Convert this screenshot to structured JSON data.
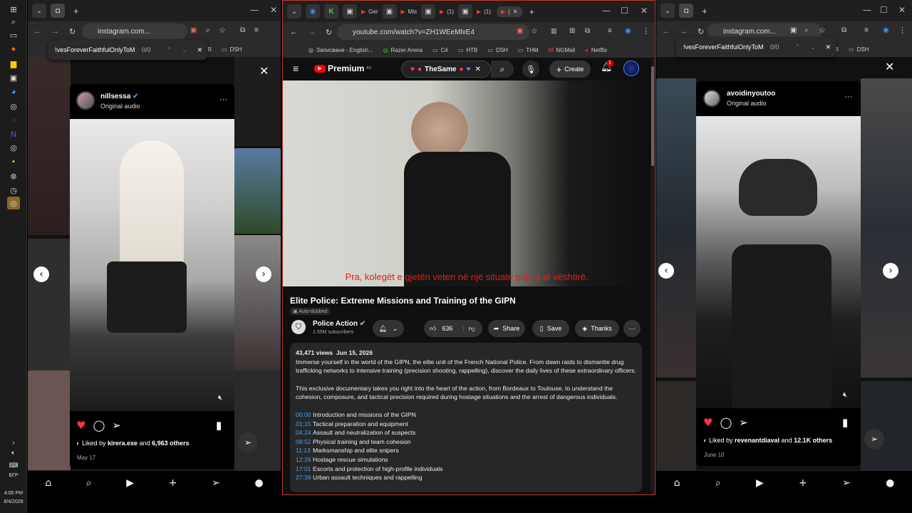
{
  "taskbar": {
    "time": "4:05 PM",
    "date": "8/4/2026",
    "lang": "БГР"
  },
  "left_window": {
    "url": "instagram.com...",
    "find_text": "!vesForeverFaithfulOnlyToMe.",
    "find_count": "0/0",
    "bookmarks": [
      "HTB",
      "DSH"
    ],
    "post": {
      "username": "nillsessa",
      "audio": "Original audio",
      "liked_by_prefix": "Liked by",
      "liked_by_user": "kirera.exe",
      "liked_by_and": "and",
      "liked_by_others": "6,963 others",
      "date": "May 17"
    }
  },
  "right_window": {
    "url": "instagram.com...",
    "find_text": "!vesForeverFaithfulOnlyToMe.",
    "find_count": "0/0",
    "bookmarks": [
      "HTB",
      "DSH"
    ],
    "post": {
      "username": "avoidinyoutoo",
      "audio": "Original audio",
      "liked_by_prefix": "Liked by",
      "liked_by_user": "revenantdiaval",
      "liked_by_and": "and",
      "liked_by_others": "12.1K others",
      "date": "June 10"
    }
  },
  "yt_window": {
    "tabs": [
      "Ger",
      "Mis",
      "(1)",
      "(1)",
      "("
    ],
    "url": "youtube.com/watch?v=ZH1WEeMlxE4",
    "bookmarks": [
      "Записване - English...",
      "Razer Arena",
      "C#",
      "HTB",
      "DSH",
      "THM",
      "NGMail",
      "Netflix"
    ],
    "logo": "Premium",
    "logo_sup": "BG",
    "search_chip": "TheSame",
    "create_label": "Create",
    "notif_count": "1",
    "subtitle": "Pra, kolegët e gjetën veten në një situatë paksa të vështirë.",
    "title": "Elite Police: Extreme Missions and Training of the GIPN",
    "auto_dubbed": "Auto-dubbed",
    "channel_name": "Police Action",
    "subscribers": "1.55M subscribers",
    "likes": "636",
    "share": "Share",
    "save": "Save",
    "thanks": "Thanks",
    "views": "43,471 views",
    "upload_date": "Jun 15, 2026",
    "desc_p1": "Immerse yourself in the world of the GIPN, the elite unit of the French National Police. From dawn raids to dismantle drug trafficking networks to intensive training (precision shooting, rappelling), discover the daily lives of these extraordinary officers.",
    "desc_p2": "This exclusive documentary takes you right into the heart of the action, from Bordeaux to Toulouse, to understand the cohesion, composure, and tactical precision required during hostage situations and the arrest of dangerous individuals.",
    "chapters": [
      {
        "time": "00:00",
        "text": "Introduction and missions of the GIPN"
      },
      {
        "time": "01:15",
        "text": "Tactical preparation and equipment"
      },
      {
        "time": "04:24",
        "text": "Assault and neutralization of suspects"
      },
      {
        "time": "08:52",
        "text": "Physical training and team cohesion"
      },
      {
        "time": "11:13",
        "text": "Marksmanship and elite snipers"
      },
      {
        "time": "12:26",
        "text": "Hostage rescue simulations"
      },
      {
        "time": "17:01",
        "text": "Escorts and protection of high-profile individuals"
      },
      {
        "time": "27:39",
        "text": "Urban assault techniques and rappelling"
      }
    ]
  }
}
